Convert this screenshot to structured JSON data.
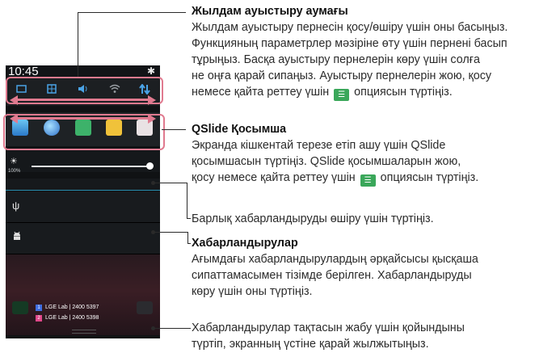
{
  "phone": {
    "time": "10:45",
    "brightness_percent": "100%",
    "brightness_level": 1.0,
    "notif_lines": [
      {
        "badge": "1",
        "badge_color": "#3f6ee0",
        "text": "LGE Lab | 2400 5397"
      },
      {
        "badge": "2",
        "badge_color": "#e0488a",
        "text": "LGE Lab | 2400 5398"
      }
    ],
    "icons": {
      "gear": "gear-icon",
      "usb": "usb-icon",
      "android": "android-icon"
    }
  },
  "sections": {
    "quick_toggle": {
      "title": "Жылдам ауыстыру аумағы",
      "lines": [
        "Жылдам ауыстыру пернесін қосу/өшіру үшін оны басыңыз.",
        "Функцияның параметрлер мәзіріне өту үшін пернені басып",
        "тұрыңыз. Басқа ауыстыру пернелерін көру үшін солға",
        "не оңға қарай сипаңыз. Ауыстыру пернелерін жою, қосу"
      ],
      "last_before": "немесе қайта реттеу үшін",
      "last_after": "опциясын түртіңіз."
    },
    "qslide": {
      "title": "QSlide Қосымша",
      "lines": [
        "Экранда кішкентай терезе етіп ашу үшін QSlide",
        "қосымшасын түртіңіз. QSlide қосымшаларын жою,"
      ],
      "last_before": "қосу немесе қайта реттеу үшін",
      "last_after": "опциясын түртіңіз."
    },
    "clear": {
      "text": "Барлық хабарландыруды өшіру үшін түртіңіз."
    },
    "notifications": {
      "title": "Хабарландырулар",
      "lines": [
        "Ағымдағы хабарландырулардың әрқайсысы қысқаша",
        "сипаттамасымен тізімде берілген. Хабарландыруды",
        "көру үшін оны түртіңіз."
      ]
    },
    "close": {
      "lines": [
        "Хабарландырулар тақтасын жабу үшін қойындыны",
        "түртіп, экранның үстіне қарай жылжытыңыз."
      ]
    }
  },
  "colors": {
    "highlight": "#e07a8f",
    "qs_blue": "#3aa0e0",
    "edit_icon": "#3aa75a"
  }
}
